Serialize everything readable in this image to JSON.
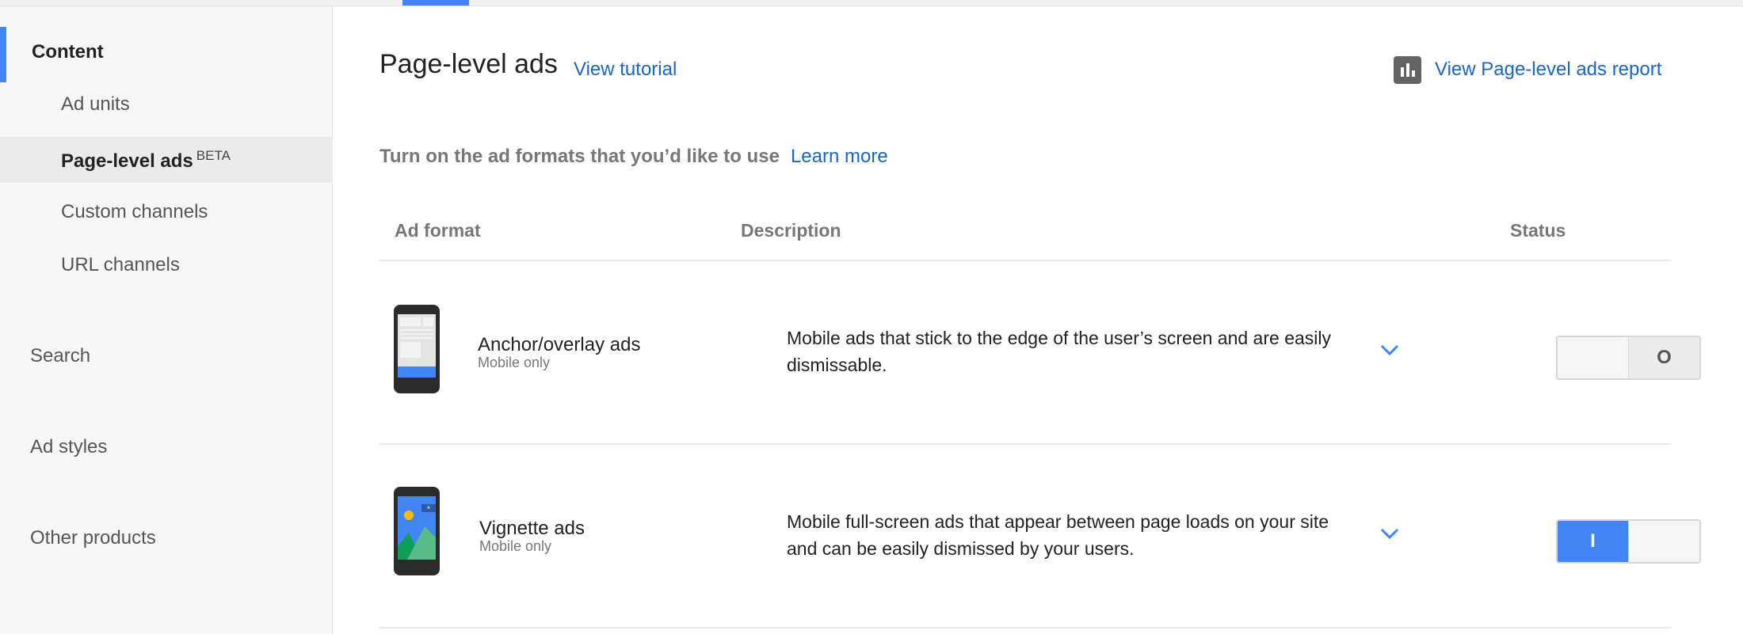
{
  "colors": {
    "accent": "#4285f4",
    "link": "#1a66c4"
  },
  "sidebar": {
    "section_content": "Content",
    "items": [
      {
        "label": "Ad units"
      },
      {
        "label": "Page-level ads",
        "badge": "BETA",
        "selected": true
      },
      {
        "label": "Custom channels"
      },
      {
        "label": "URL channels"
      }
    ],
    "sections": [
      {
        "label": "Search"
      },
      {
        "label": "Ad styles"
      },
      {
        "label": "Other products"
      }
    ]
  },
  "header": {
    "title": "Page-level ads",
    "tutorial_link": "View tutorial",
    "report_icon": "bar-chart-icon",
    "report_link": "View Page-level ads report"
  },
  "instructions": {
    "text": "Turn on the ad formats that you’d like to use",
    "learn_more": "Learn more"
  },
  "table": {
    "columns": [
      "Ad format",
      "Description",
      "Status"
    ],
    "rows": [
      {
        "name": "Anchor/overlay ads",
        "sub": "Mobile only",
        "icon": "phone-anchor-icon",
        "description": "Mobile ads that stick to the edge of the user’s screen and are easily dismissable.",
        "status_label": "O",
        "status_on": false
      },
      {
        "name": "Vignette ads",
        "sub": "Mobile only",
        "icon": "phone-vignette-icon",
        "description": "Mobile full-screen ads that appear between page loads on your site and can be easily dismissed by your users.",
        "status_label": "I",
        "status_on": true
      }
    ]
  }
}
